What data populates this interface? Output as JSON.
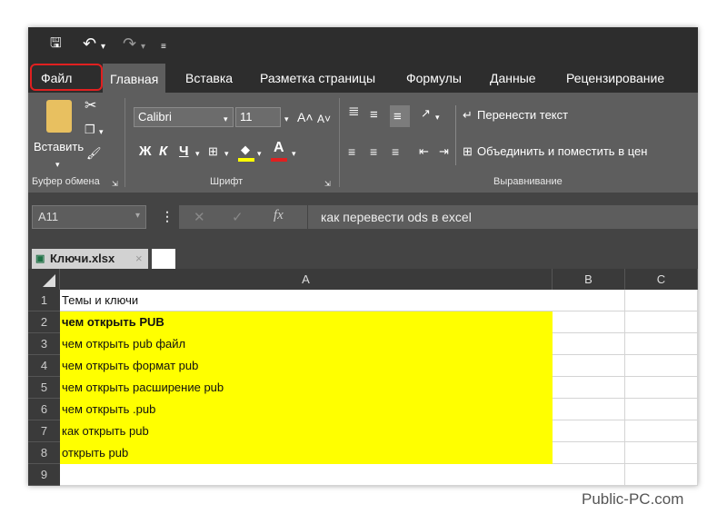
{
  "quick_access": {
    "save_icon": "save-icon",
    "undo_icon": "undo-icon",
    "redo_icon": "redo-icon"
  },
  "tabs": [
    "Файл",
    "Главная",
    "Вставка",
    "Разметка страницы",
    "Формулы",
    "Данные",
    "Рецензирование"
  ],
  "active_tab": "Главная",
  "ribbon": {
    "paste_label": "Вставить",
    "font_name": "Calibri",
    "font_size": "11",
    "bold": "Ж",
    "italic": "К",
    "underline": "Ч",
    "wrap_text": "Перенести текст",
    "merge_center": "Объединить и поместить в цен",
    "group_clipboard": "Буфер обмена",
    "group_font": "Шрифт",
    "group_alignment": "Выравнивание",
    "font_color": "#e02020",
    "fill_color": "#ffff00"
  },
  "formula_bar": {
    "name_box": "A11",
    "fx": "fx",
    "formula": "как перевести ods в excel"
  },
  "sheet_tab": "Ключи.xlsx",
  "columns": [
    "A",
    "B",
    "C"
  ],
  "rows": [
    {
      "num": "1",
      "text": "Темы и ключи",
      "highlight": false,
      "bold": false
    },
    {
      "num": "2",
      "text": "чем открыть PUB",
      "highlight": true,
      "bold": true
    },
    {
      "num": "3",
      "text": "чем открыть pub файл",
      "highlight": true,
      "bold": false
    },
    {
      "num": "4",
      "text": "чем открыть формат pub",
      "highlight": true,
      "bold": false
    },
    {
      "num": "5",
      "text": "чем открыть расширение pub",
      "highlight": true,
      "bold": false
    },
    {
      "num": "6",
      "text": "чем открыть .pub",
      "highlight": true,
      "bold": false
    },
    {
      "num": "7",
      "text": "как открыть pub",
      "highlight": true,
      "bold": false
    },
    {
      "num": "8",
      "text": "открыть pub",
      "highlight": true,
      "bold": false
    },
    {
      "num": "9",
      "text": "",
      "highlight": false,
      "bold": false
    }
  ],
  "highlight_color": "#ffff00",
  "watermark": "Public-PC.com"
}
